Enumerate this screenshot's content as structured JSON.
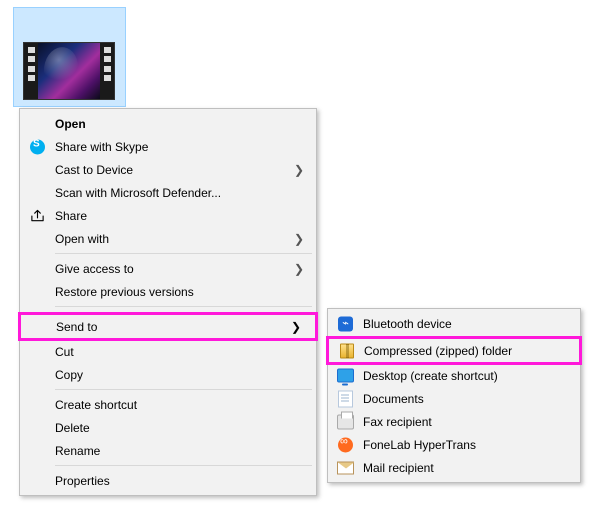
{
  "main_menu": {
    "open": "Open",
    "skype": "Share with Skype",
    "cast": "Cast to Device",
    "defender": "Scan with Microsoft Defender...",
    "share": "Share",
    "open_with": "Open with",
    "give_access": "Give access to",
    "restore": "Restore previous versions",
    "send_to": "Send to",
    "cut": "Cut",
    "copy": "Copy",
    "create_shortcut": "Create shortcut",
    "delete": "Delete",
    "rename": "Rename",
    "properties": "Properties"
  },
  "send_to_menu": {
    "bluetooth": "Bluetooth device",
    "compressed": "Compressed (zipped) folder",
    "desktop": "Desktop (create shortcut)",
    "documents": "Documents",
    "fax": "Fax recipient",
    "fonelab": "FoneLab HyperTrans",
    "mail": "Mail recipient"
  },
  "glyphs": {
    "chevron": "❯",
    "bluetooth": "⌁"
  }
}
